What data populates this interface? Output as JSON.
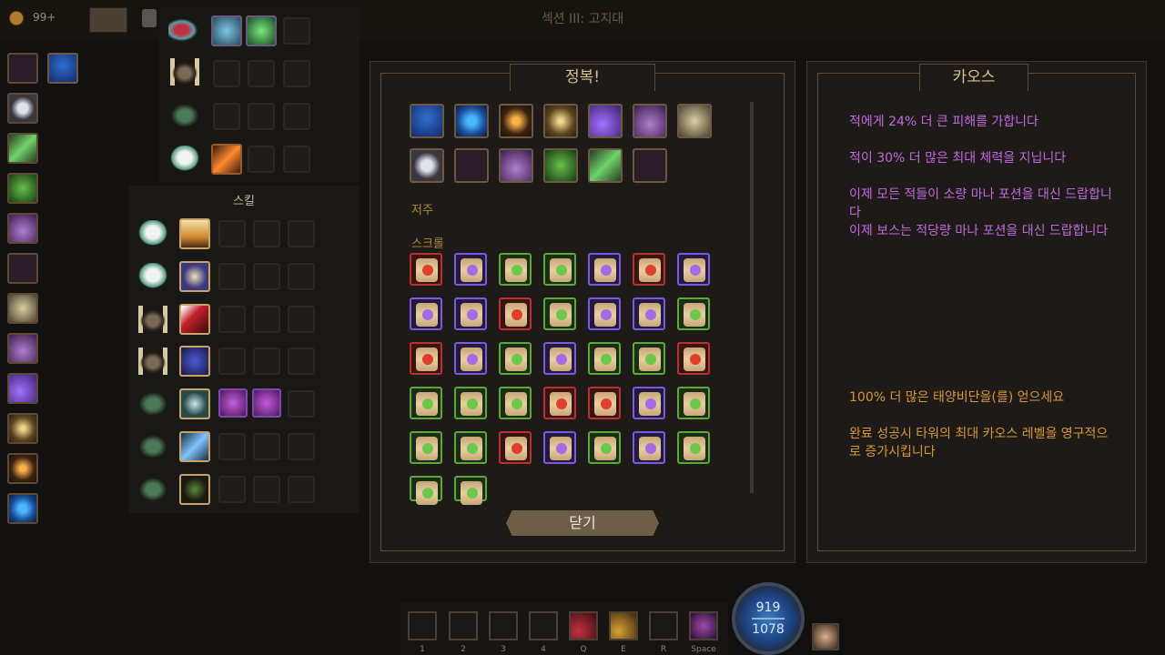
{
  "topbar": {
    "gold": "99+",
    "region": "섹션 III: 고지대"
  },
  "skills_panel": {
    "title": "스킬"
  },
  "conquest_panel": {
    "title": "정복!",
    "curse_label": "저주",
    "scroll_label": "스크롤",
    "relics_row1": [
      "blue-shield-icon",
      "blue-spiral-icon",
      "fire-orb-icon",
      "golden-burst-icon",
      "purple-claw-icon",
      "pink-halo-icon",
      "compass-icon"
    ],
    "relics_row2": [
      "white-skull-icon",
      "winged-boot-icon",
      "candle-icon",
      "green-potion-icon",
      "leaf-icon",
      "scythe-icon"
    ],
    "scroll_rows": [
      [
        "red",
        "purple",
        "green",
        "green",
        "purple",
        "red",
        "purple"
      ],
      [
        "purple",
        "purple",
        "red",
        "green",
        "purple",
        "purple",
        "green"
      ],
      [
        "red",
        "purple",
        "green",
        "purple",
        "green",
        "green",
        "red"
      ],
      [
        "green",
        "green",
        "green",
        "red",
        "red",
        "purple",
        "green"
      ],
      [
        "green",
        "green",
        "red",
        "purple",
        "green",
        "purple",
        "green"
      ],
      [
        "green",
        "green"
      ]
    ],
    "close_button": "닫기"
  },
  "chaos_panel": {
    "title": "카오스",
    "effects": [
      "적에게 24% 더 큰 피해를 가합니다",
      "적이 30% 더 많은 최대 체력을 지닙니다",
      "이제 모든 적들이 소량 마나 포션을 대신 드랍합니다",
      "이제 보스는 적당량 마나 포션을 대신 드랍합니다"
    ],
    "reward": "100% 더 많은 태양비단을(를) 얻으세요",
    "permanent": "완료 성공시 타워의 최대 카오스 레벨을 영구적으로 증가시킵니다"
  },
  "hotbar": {
    "keys": [
      "1",
      "2",
      "3",
      "4",
      "Q",
      "E",
      "R",
      "Space"
    ],
    "mana_current": "919",
    "mana_max": "1078"
  },
  "colors": {
    "scroll_red": "#b83030",
    "scroll_purple": "#7a5ae0",
    "scroll_green": "#5aa83a",
    "chaos_text": "#c16ae0",
    "reward_text": "#d89a30"
  }
}
